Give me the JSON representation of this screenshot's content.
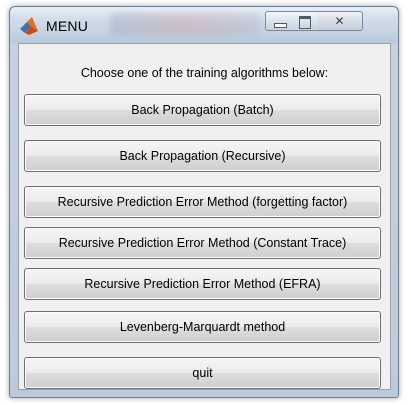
{
  "window": {
    "title": "MENU"
  },
  "menu": {
    "heading": "Choose one of the training algorithms below:",
    "buttons": [
      {
        "label": "Back Propagation (Batch)"
      },
      {
        "label": "Back Propagation (Recursive)"
      },
      {
        "label": "Recursive Prediction Error Method (forgetting factor)"
      },
      {
        "label": "Recursive Prediction Error Method (Constant Trace)"
      },
      {
        "label": "Recursive Prediction Error Method (EFRA)"
      },
      {
        "label": "Levenberg-Marquardt method"
      },
      {
        "label": "quit"
      }
    ]
  },
  "icons": {
    "app": "matlab-icon",
    "minimize": "minimize-icon",
    "maximize": "maximize-icon",
    "close": "close-icon"
  },
  "colors": {
    "panel_background": "#f0f0f0",
    "titlebar": "#cfdbe8"
  }
}
